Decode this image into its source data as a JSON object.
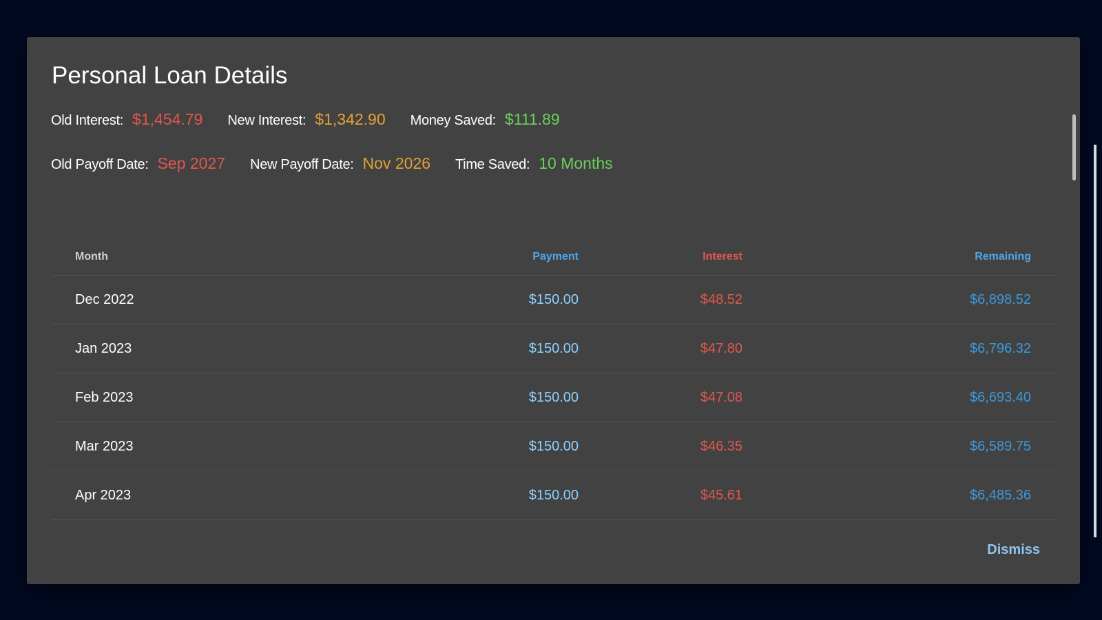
{
  "dialog": {
    "title": "Personal Loan Details",
    "stats": {
      "old_interest_label": "Old Interest:",
      "old_interest_value": "$1,454.79",
      "new_interest_label": "New Interest:",
      "new_interest_value": "$1,342.90",
      "money_saved_label": "Money Saved:",
      "money_saved_value": "$111.89",
      "old_payoff_label": "Old Payoff Date:",
      "old_payoff_value": "Sep 2027",
      "new_payoff_label": "New Payoff Date:",
      "new_payoff_value": "Nov 2026",
      "time_saved_label": "Time Saved:",
      "time_saved_value": "10 Months"
    },
    "table": {
      "headers": {
        "month": "Month",
        "payment": "Payment",
        "interest": "Interest",
        "remaining": "Remaining"
      },
      "rows": [
        {
          "month": "Dec 2022",
          "payment": "$150.00",
          "interest": "$48.52",
          "remaining": "$6,898.52"
        },
        {
          "month": "Jan 2023",
          "payment": "$150.00",
          "interest": "$47.80",
          "remaining": "$6,796.32"
        },
        {
          "month": "Feb 2023",
          "payment": "$150.00",
          "interest": "$47.08",
          "remaining": "$6,693.40"
        },
        {
          "month": "Mar 2023",
          "payment": "$150.00",
          "interest": "$46.35",
          "remaining": "$6,589.75"
        },
        {
          "month": "Apr 2023",
          "payment": "$150.00",
          "interest": "$45.61",
          "remaining": "$6,485.36"
        }
      ]
    },
    "dismiss_label": "Dismiss"
  },
  "colors": {
    "background": "#020a22",
    "dialog": "#424242",
    "old_red": "#e2574c",
    "new_orange": "#e0a135",
    "saved_green": "#6ccf5a",
    "remaining_blue": "#3d98d9"
  }
}
